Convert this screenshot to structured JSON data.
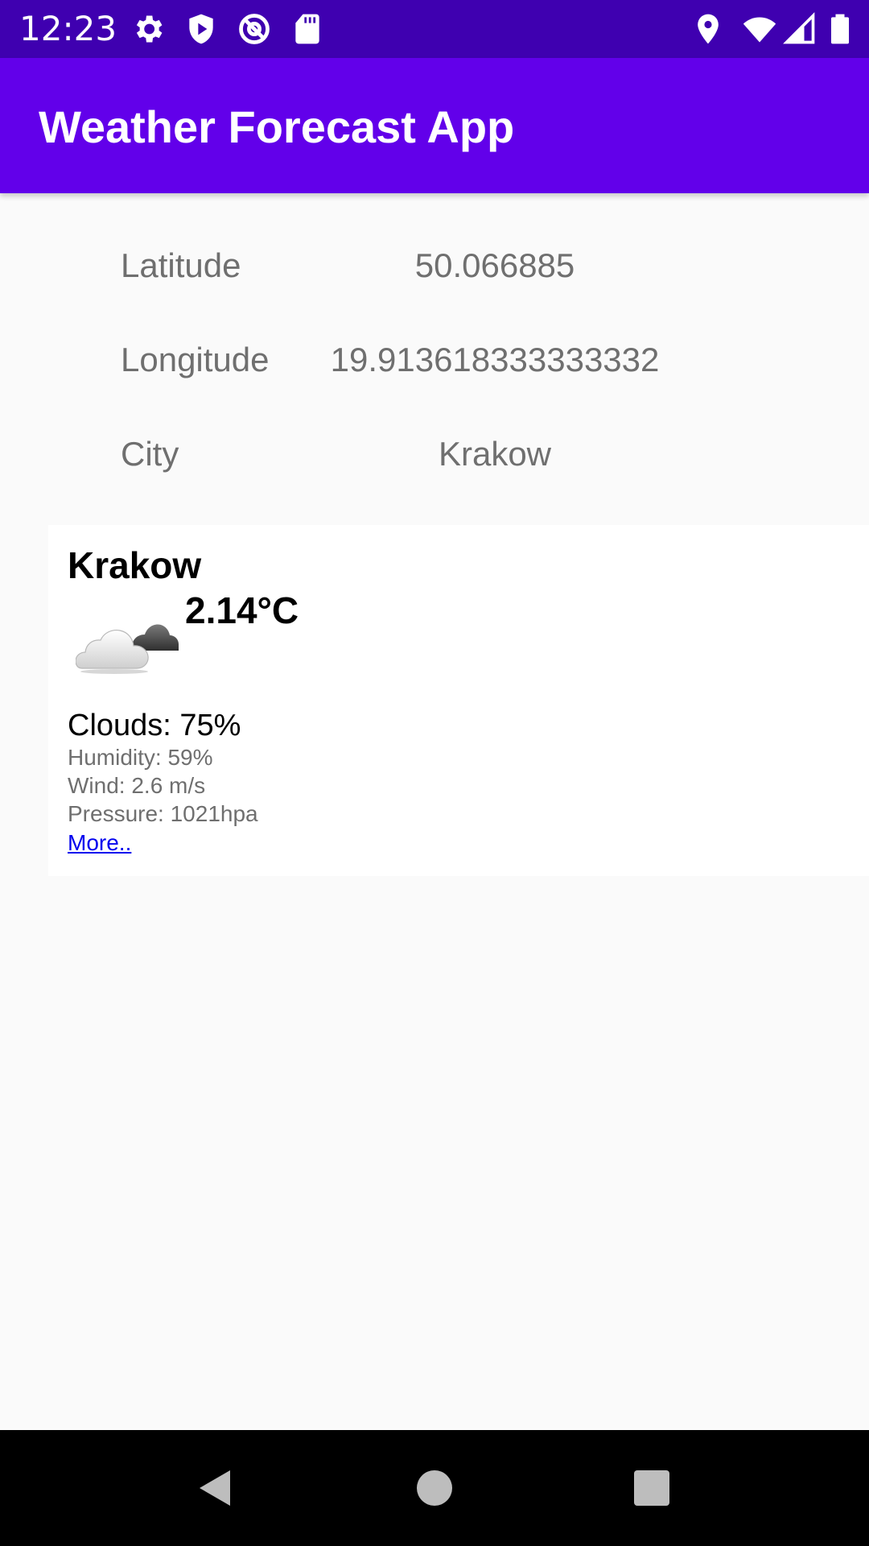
{
  "status_bar": {
    "time": "12:23",
    "left_icons": [
      "settings-icon",
      "shield-play-icon",
      "at-sign-icon",
      "sd-card-icon"
    ],
    "right_icons": [
      "location-icon",
      "wifi-icon",
      "signal-icon",
      "battery-icon"
    ]
  },
  "app_bar": {
    "title": "Weather Forecast App",
    "color": "#6200ea",
    "status_color": "#3f00b0"
  },
  "info": {
    "latitude_label": "Latitude",
    "latitude_value": "50.066885",
    "longitude_label": "Longitude",
    "longitude_value": "19.913618333333332",
    "city_label": "City",
    "city_value": "Krakow"
  },
  "weather_card": {
    "city": "Krakow",
    "icon": "cloudy-icon",
    "temperature": "2.14°C",
    "clouds": "Clouds: 75%",
    "humidity": "Humidity: 59%",
    "wind": "Wind: 2.6 m/s",
    "pressure": "Pressure: 1021hpa",
    "more_link": "More.."
  },
  "nav_bar": {
    "buttons": [
      "back-icon",
      "home-icon",
      "recents-icon"
    ]
  }
}
